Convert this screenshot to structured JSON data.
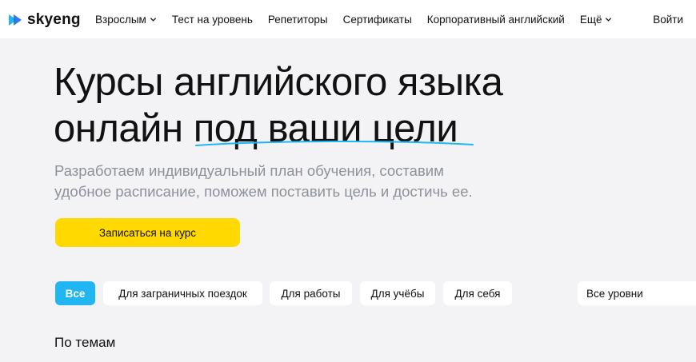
{
  "brand": {
    "name": "skyeng",
    "accent": "#21b6f2",
    "cta_color": "#ffd900"
  },
  "nav": {
    "items": [
      {
        "label": "Взрослым",
        "has_dropdown": true
      },
      {
        "label": "Тест на уровень",
        "has_dropdown": false
      },
      {
        "label": "Репетиторы",
        "has_dropdown": false
      },
      {
        "label": "Сертификаты",
        "has_dropdown": false
      },
      {
        "label": "Корпоративный английский",
        "has_dropdown": false
      },
      {
        "label": "Ещё",
        "has_dropdown": true
      }
    ],
    "login": "Войти"
  },
  "hero": {
    "title_line1": "Курсы английского языка",
    "title_line2": "онлайн под ваши цели",
    "subtitle_line1": "Разработаем индивидуальный план обучения, составим",
    "subtitle_line2": "удобное расписание, поможем поставить цель и достичь ее.",
    "cta_label": "Записаться на курс"
  },
  "filters": {
    "items": [
      {
        "label": "Все",
        "active": true
      },
      {
        "label": "Для заграничных поездок",
        "active": false
      },
      {
        "label": "Для работы",
        "active": false
      },
      {
        "label": "Для учёбы",
        "active": false
      },
      {
        "label": "Для себя",
        "active": false
      }
    ],
    "level_select": "Все уровни"
  },
  "section": {
    "title": "По темам"
  }
}
